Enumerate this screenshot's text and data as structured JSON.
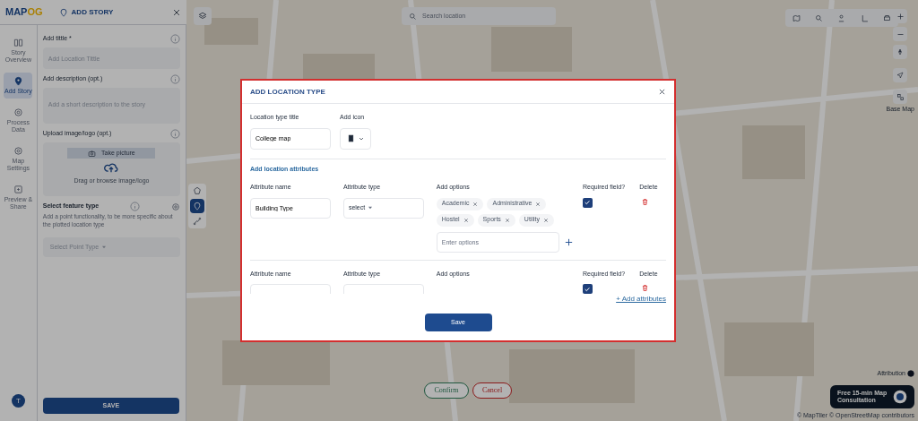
{
  "logo": {
    "left": "MAP",
    "right": "OG"
  },
  "rail": [
    {
      "label": "Story Overview",
      "selected": false
    },
    {
      "label": "Add Story",
      "selected": true
    },
    {
      "label": "Process Data",
      "selected": false
    },
    {
      "label": "Map Settings",
      "selected": false
    },
    {
      "label": "Preview & Share",
      "selected": false
    }
  ],
  "avatar": "T",
  "panel": {
    "title": "ADD STORY",
    "fields": [
      {
        "kind": "input",
        "label": "Add tittle *",
        "placeholder": "Add Location Tittle"
      },
      {
        "kind": "textarea",
        "label": "Add description (opt.)",
        "placeholder": "Add a short description to the story"
      },
      {
        "kind": "upload",
        "label": "Upload image/logo (opt.)",
        "button": "Take picture",
        "hint": "Drag or browse image/logo"
      },
      {
        "kind": "select",
        "label": "Select feature type",
        "help": "Add a point functionality, to be more specific about the plotted location type",
        "placeholder": "Select Point Type"
      }
    ],
    "save": "SAVE"
  },
  "map": {
    "search_placeholder": "Search location",
    "base_map": "Base Map",
    "attribution": "Attribution",
    "consultation": "Free 15-min Map Consultation",
    "credits": "© MapTiler © OpenStreetMap contributors",
    "confirm": "Confirm",
    "cancel": "Cancel"
  },
  "modal": {
    "title": "ADD LOCATION TYPE",
    "type_title_label": "Location type title",
    "type_title_value": "College map",
    "icon_label": "Add icon",
    "section": "Add location attributes",
    "attributes": [
      {
        "name_label": "Attribute name",
        "name_value": "Building Type",
        "type_label": "Attribute type",
        "type_value": "select",
        "options_label": "Add options",
        "options": [
          "Academic",
          "Administrative",
          "Hostel",
          "Sports",
          "Utility"
        ],
        "options_placeholder": "Enter options",
        "required_label": "Required field?",
        "required": true,
        "delete_label": "Delete"
      },
      {
        "name_label": "Attribute name",
        "type_label": "Attribute type",
        "options_label": "Add options",
        "required_label": "Required field?",
        "required": true,
        "delete_label": "Delete"
      }
    ],
    "add_link": "+ Add attributes",
    "save": "Save"
  }
}
